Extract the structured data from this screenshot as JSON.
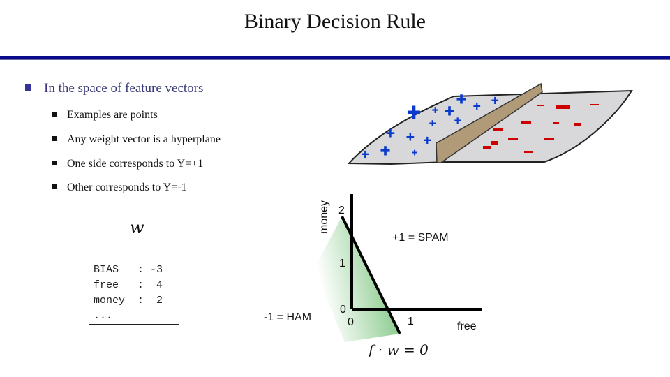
{
  "slide": {
    "title": "Binary Decision Rule",
    "accent_color": "#0a0a8c",
    "bullets": {
      "main": "In the space of feature vectors",
      "sub": [
        "Examples are points",
        "Any weight vector is a hyperplane",
        "One side corresponds to Y=+1",
        "Other corresponds to Y=-1"
      ]
    },
    "weight_vector": {
      "label": "w",
      "rows": [
        {
          "feature": "BIAS",
          "value": "-3"
        },
        {
          "feature": "free",
          "value": "4"
        },
        {
          "feature": "money",
          "value": "2"
        },
        {
          "feature": "...",
          "value": ""
        }
      ]
    }
  },
  "illustration": {
    "description": "hyperplane wall separating plus and minus points",
    "positive_color": "#0a3acc",
    "negative_color": "#cc0000",
    "wall_color": "#b09a78",
    "plane_color": "#d8d8da"
  },
  "plot": {
    "x_label": "free",
    "y_label": "money",
    "x_ticks": [
      "0",
      "1"
    ],
    "y_ticks": [
      "0",
      "1",
      "2"
    ],
    "positive_region_label": "+1 = SPAM",
    "negative_region_label": "-1 = HAM",
    "boundary_label": "f · w = 0",
    "negative_region_color": "#4caf50"
  }
}
